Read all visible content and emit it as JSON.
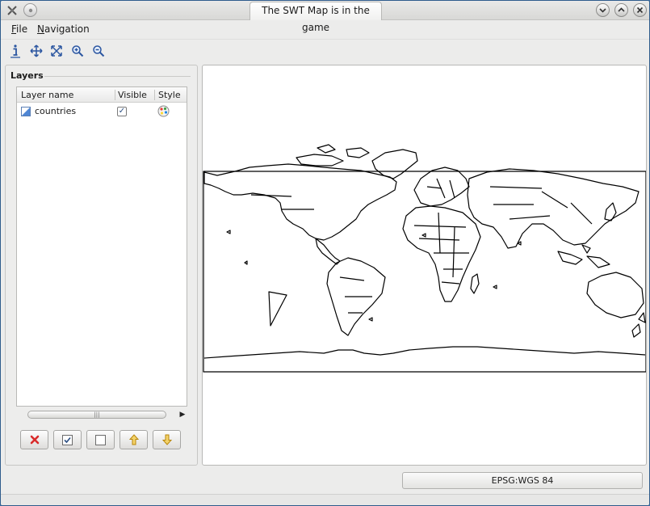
{
  "window": {
    "title": "The SWT Map is in the game",
    "controls": {
      "minimize": "minimize",
      "maximize": "maximize",
      "close": "close"
    }
  },
  "menubar": {
    "items": [
      {
        "label": "File"
      },
      {
        "label": "Navigation"
      }
    ]
  },
  "toolbar": {
    "tools": [
      {
        "icon": "info-icon"
      },
      {
        "icon": "pan-icon"
      },
      {
        "icon": "zoom-extent-icon"
      },
      {
        "icon": "zoom-in-icon"
      },
      {
        "icon": "zoom-out-icon"
      }
    ]
  },
  "layers": {
    "title": "Layers",
    "columns": {
      "name": "Layer name",
      "visible": "Visible",
      "style": "Style"
    },
    "rows": [
      {
        "name": "countries",
        "visible": true
      }
    ],
    "buttons": [
      {
        "icon": "remove-icon"
      },
      {
        "icon": "check-all-icon"
      },
      {
        "icon": "uncheck-all-icon"
      },
      {
        "icon": "move-up-icon"
      },
      {
        "icon": "move-down-icon"
      }
    ],
    "colors": {
      "remove": "#d92b2b",
      "arrow": "#e8b923"
    }
  },
  "status": {
    "crs": "EPSG:WGS 84"
  }
}
